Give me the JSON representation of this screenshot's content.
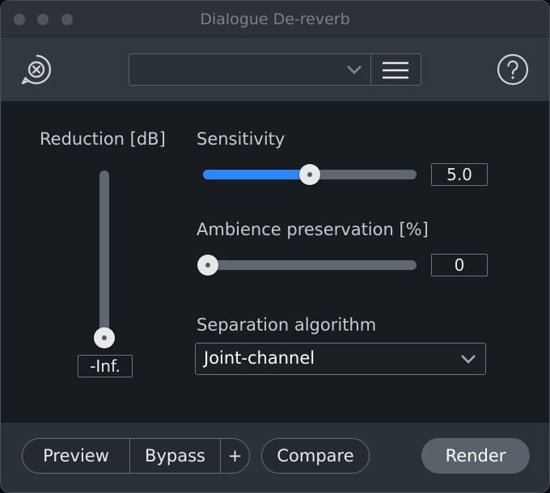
{
  "window": {
    "title": "Dialogue De-reverb"
  },
  "toolbar": {
    "preset_value": "",
    "logo_icon": "x-circle-chat-icon",
    "help_icon": "question-circle-icon",
    "menu_icon": "hamburger-icon"
  },
  "reduction": {
    "label": "Reduction [dB]",
    "value": "-Inf.",
    "level": 0
  },
  "sensitivity": {
    "label": "Sensitivity",
    "value": "5.0",
    "fraction": 0.5
  },
  "ambience": {
    "label": "Ambience preservation [%]",
    "value": "0",
    "fraction": 0
  },
  "separation": {
    "label": "Separation algorithm",
    "selected": "Joint-channel"
  },
  "footer": {
    "preview": "Preview",
    "bypass": "Bypass",
    "plus": "+",
    "compare": "Compare",
    "render": "Render"
  },
  "colors": {
    "accent": "#2f86f6"
  }
}
